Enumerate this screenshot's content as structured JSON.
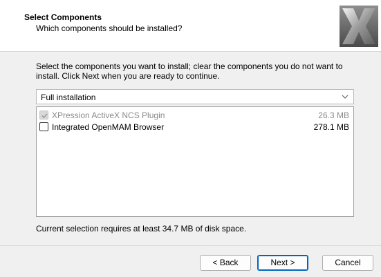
{
  "header": {
    "title": "Select Components",
    "subtitle": "Which components should be installed?",
    "logo_icon": "x-logo-icon"
  },
  "instructions": "Select the components you want to install; clear the components you do not want to install. Click Next when you are ready to continue.",
  "install_type": {
    "selected": "Full installation"
  },
  "components": [
    {
      "name": "XPression ActiveX NCS Plugin",
      "size": "26.3 MB",
      "checked": true,
      "disabled": true
    },
    {
      "name": "Integrated OpenMAM Browser",
      "size": "278.1 MB",
      "checked": false,
      "disabled": false
    }
  ],
  "space_note": "Current selection requires at least 34.7 MB of disk space.",
  "buttons": {
    "back": "< Back",
    "next": "Next >",
    "cancel": "Cancel"
  },
  "colors": {
    "accent": "#0067c0",
    "dialog_bg": "#f0f0f0",
    "disabled_text": "#8a8a8a"
  }
}
